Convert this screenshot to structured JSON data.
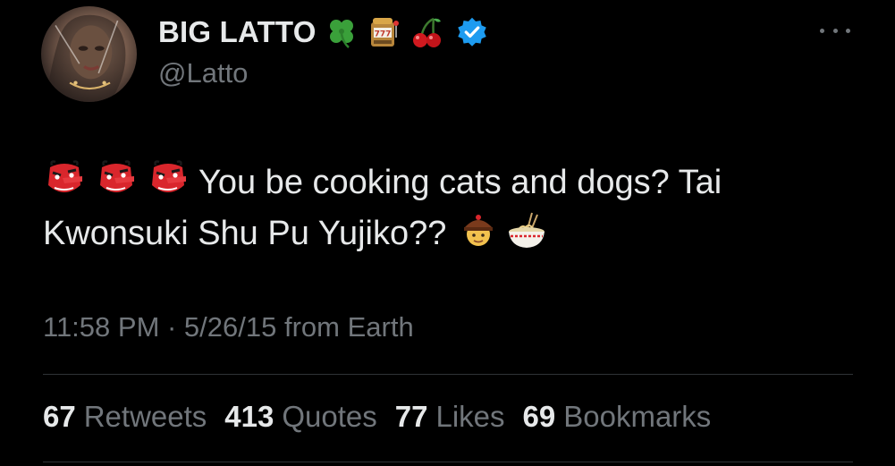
{
  "author": {
    "display_name": "BIG LATTO",
    "handle": "@Latto",
    "name_emojis": [
      "four-leaf-clover-icon",
      "slot-machine-icon",
      "cherries-icon"
    ],
    "verified": true,
    "verified_color": "#1d9bf0"
  },
  "tweet": {
    "leading_emojis": [
      "tengu-mask-icon",
      "tengu-mask-icon",
      "tengu-mask-icon"
    ],
    "text": "You be cooking cats and dogs? Tai Kwonsuki Shu Pu Yujiko??",
    "trailing_emojis": [
      "man-with-chinese-cap-icon",
      "bowl-of-noodles-icon"
    ]
  },
  "meta": {
    "timestamp": "11:58 PM · 5/26/15 from Earth"
  },
  "stats": [
    {
      "count": "67",
      "label": "Retweets"
    },
    {
      "count": "413",
      "label": "Quotes"
    },
    {
      "count": "77",
      "label": "Likes"
    },
    {
      "count": "69",
      "label": "Bookmarks"
    }
  ],
  "colors": {
    "background": "#000000",
    "primary_text": "#e7e9ea",
    "secondary_text": "#71767b",
    "divider": "#2f3336"
  }
}
